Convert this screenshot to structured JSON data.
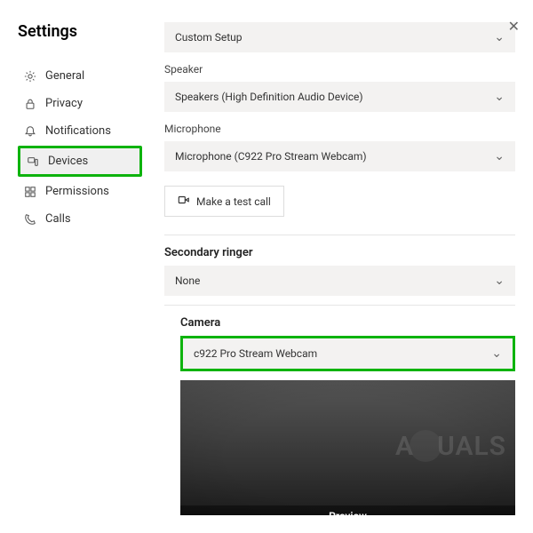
{
  "title": "Settings",
  "nav": [
    {
      "label": "General",
      "icon": "gear"
    },
    {
      "label": "Privacy",
      "icon": "lock"
    },
    {
      "label": "Notifications",
      "icon": "bell"
    },
    {
      "label": "Devices",
      "icon": "device"
    },
    {
      "label": "Permissions",
      "icon": "app"
    },
    {
      "label": "Calls",
      "icon": "phone"
    }
  ],
  "audio": {
    "profile_value": "Custom Setup",
    "speaker_label": "Speaker",
    "speaker_value": "Speakers (High Definition Audio Device)",
    "microphone_label": "Microphone",
    "microphone_value": "Microphone (C922 Pro Stream Webcam)",
    "test_call_label": "Make a test call"
  },
  "secondary_ringer": {
    "label": "Secondary ringer",
    "value": "None"
  },
  "camera": {
    "label": "Camera",
    "value": "c922 Pro Stream Webcam",
    "preview_label": "Preview"
  },
  "watermark": {
    "prefix": "A",
    "suffix": "UALS"
  }
}
